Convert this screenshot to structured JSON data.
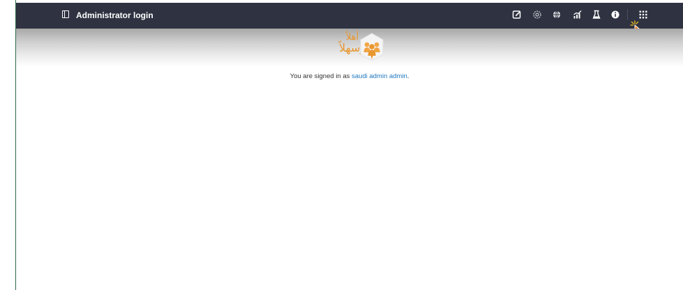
{
  "header": {
    "title": "Administrator login",
    "icons": [
      "edit-icon",
      "settings-icon",
      "globe-icon",
      "chart-icon",
      "flask-icon",
      "info-icon",
      "apps-grid-icon"
    ]
  },
  "logo": {
    "line1": "أهلاً",
    "line2": "وسهلاً",
    "color": "#e8962e"
  },
  "session": {
    "prefix": "You are signed in as ",
    "username": "saudi admin admin",
    "suffix": "."
  },
  "colors": {
    "topbar": "#2f3341",
    "link": "#1f78c1",
    "accent": "#e8962e"
  }
}
